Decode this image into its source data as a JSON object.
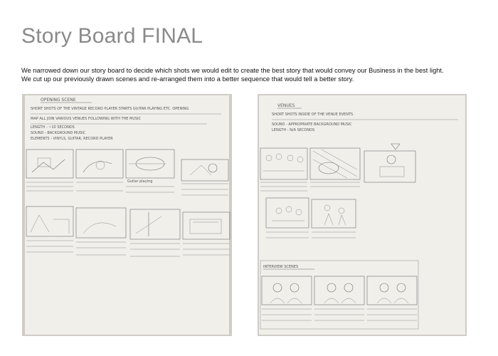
{
  "page": {
    "title": "Story Board FINAL",
    "intro_line1": "We narrowed down our story board to decide which shots we would edit to create the best story that would convey our Business in the best light.",
    "intro_line2": "We cut up our previously drawn scenes and re-arranged them into a better sequence that would tell a better story."
  },
  "left_photo": {
    "heading": "OPENING SCENE",
    "notes": [
      "SHORT SHOTS OF THE VINTAGE RECORD PLAYER STARTS GUITAR PLAYING ETC. OPENING",
      "MAP ALL JOIN VARIOUS VENUES FOLLOWING WITH THE MUSIC",
      "LENGTH - ~10 SECONDS",
      "SOUND - BACKGROUND MUSIC",
      "ELEMENTS - VINYLS, GUITAR, RECORD PLAYER"
    ],
    "frame_captions": [
      "Guitar playing",
      "",
      "",
      "",
      "",
      "",
      "",
      ""
    ]
  },
  "right_photo": {
    "heading": "VENUES",
    "notes": [
      "SHORT SHOTS INSIDE OF THE VENUE EVENTS",
      "SOUND - APPROPRIATE BACKGROUND MUSIC",
      "LENGTH - N/A SECONDS"
    ],
    "frame_captions": [
      "",
      "",
      "",
      "",
      ""
    ],
    "interview_heading": "INTERVIEW SCENES"
  },
  "colors": {
    "title": "#8a8a8a",
    "photo_background": "#cfccc6",
    "paper": "#f1efea"
  }
}
